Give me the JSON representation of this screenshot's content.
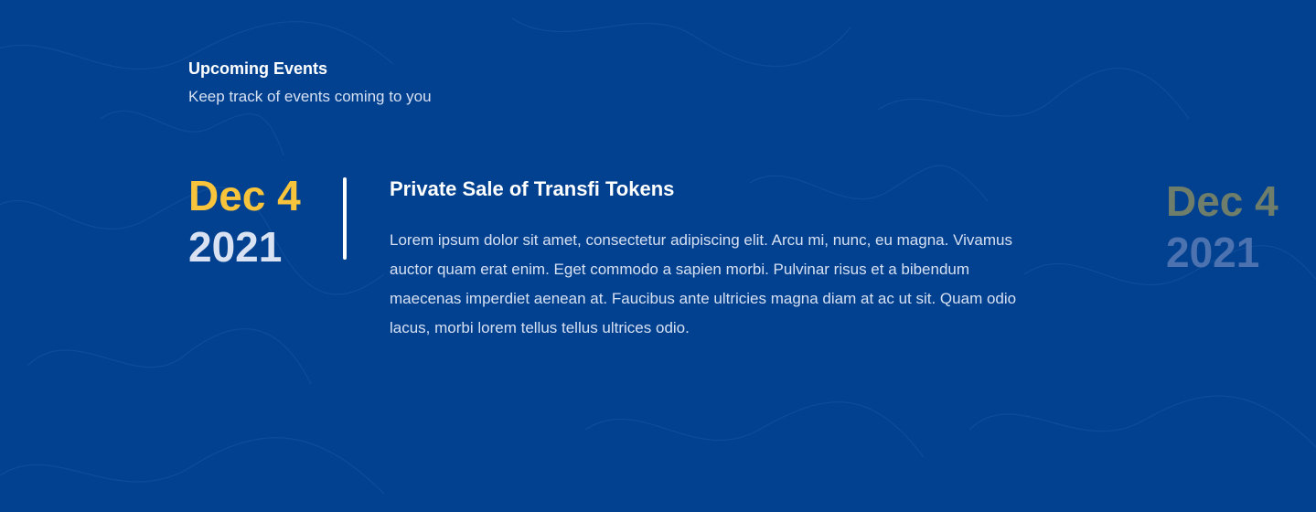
{
  "section": {
    "title": "Upcoming Events",
    "subtitle": "Keep track of events coming to you"
  },
  "events": [
    {
      "month_day": "Dec 4",
      "year": "2021",
      "title": "Private Sale of Transfi Tokens",
      "description": "Lorem ipsum dolor sit amet, consectetur adipiscing elit. Arcu mi, nunc, eu magna. Vivamus auctor quam erat enim. Eget commodo a sapien morbi. Pulvinar risus et a bibendum maecenas imperdiet aenean at. Faucibus ante ultricies magna diam at ac ut sit. Quam odio lacus, morbi lorem tellus tellus ultrices odio."
    },
    {
      "month_day": "Dec 4",
      "year": "2021"
    }
  ],
  "colors": {
    "background": "#02418f",
    "accent": "#f7c43b",
    "text_primary": "#ffffff",
    "text_secondary": "#d6e0f3"
  }
}
